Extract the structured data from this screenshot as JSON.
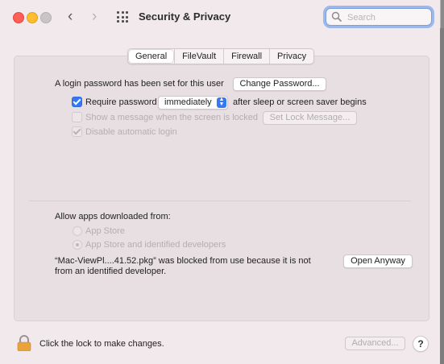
{
  "window": {
    "title": "Security & Privacy",
    "search_placeholder": "Search"
  },
  "tabs": [
    {
      "label": "General",
      "active": true
    },
    {
      "label": "FileVault",
      "active": false
    },
    {
      "label": "Firewall",
      "active": false
    },
    {
      "label": "Privacy",
      "active": false
    }
  ],
  "general": {
    "login_password_text": "A login password has been set for this user",
    "change_password_label": "Change Password...",
    "require_password_label": "Require password",
    "require_password_checked": true,
    "require_password_timing": "immediately",
    "after_sleep_text": "after sleep or screen saver begins",
    "show_message_label": "Show a message when the screen is locked",
    "show_message_checked": false,
    "set_lock_message_label": "Set Lock Message...",
    "disable_auto_login_label": "Disable automatic login",
    "disable_auto_login_checked": true
  },
  "downloads": {
    "heading": "Allow apps downloaded from:",
    "options": [
      {
        "label": "App Store",
        "selected": false
      },
      {
        "label": "App Store and identified developers",
        "selected": true
      }
    ],
    "blocked_line1": "“Mac-ViewPl....41.52.pkg” was blocked from use because it is not",
    "blocked_line2": "from an identified developer.",
    "open_anyway_label": "Open Anyway"
  },
  "footer": {
    "lock_text": "Click the lock to make changes.",
    "advanced_label": "Advanced...",
    "help_label": "?"
  },
  "colors": {
    "accent": "#3478f6",
    "close": "#fe5f57",
    "minimize": "#febc2e",
    "lock": "#e8a43a"
  }
}
